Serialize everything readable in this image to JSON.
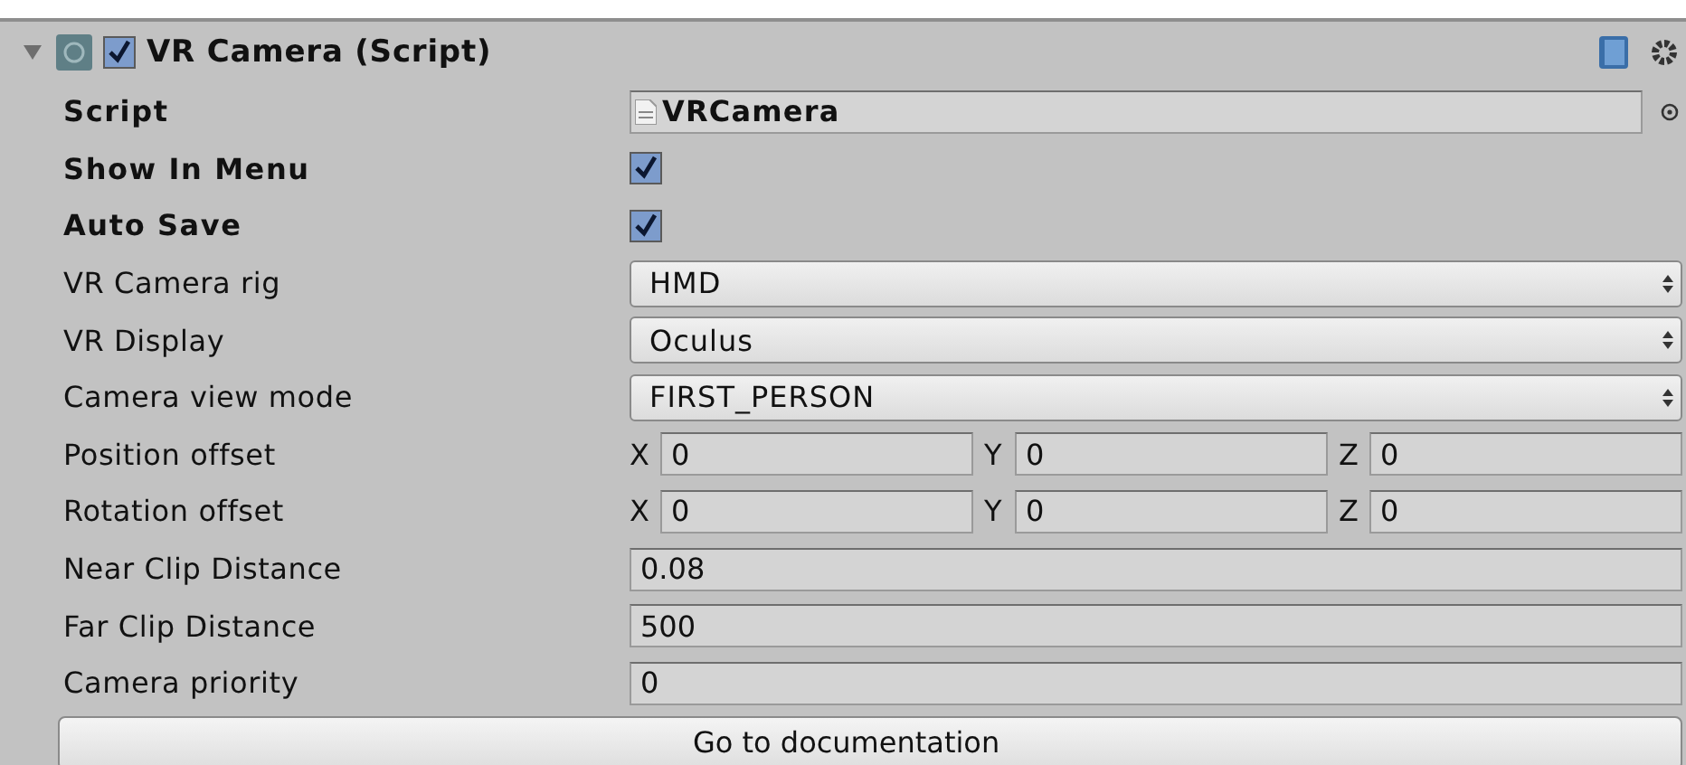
{
  "component": {
    "title": "VR Camera (Script)",
    "expanded": true,
    "enabled": true
  },
  "rows": [
    {
      "kind": "object",
      "label": "Script",
      "bold": true,
      "value": "VRCamera"
    },
    {
      "kind": "checkbox",
      "label": "Show In Menu",
      "bold": true,
      "checked": true
    },
    {
      "kind": "checkbox",
      "label": "Auto Save",
      "bold": true,
      "checked": true
    },
    {
      "kind": "dropdown",
      "label": "VR Camera rig",
      "bold": false,
      "value": "HMD"
    },
    {
      "kind": "dropdown",
      "label": "VR Display",
      "bold": false,
      "value": "Oculus"
    },
    {
      "kind": "dropdown",
      "label": "Camera view mode",
      "bold": false,
      "value": "FIRST_PERSON"
    },
    {
      "kind": "vector",
      "label": "Position offset",
      "bold": false,
      "axes": [
        {
          "axis": "X",
          "value": "0"
        },
        {
          "axis": "Y",
          "value": "0"
        },
        {
          "axis": "Z",
          "value": "0"
        }
      ]
    },
    {
      "kind": "vector",
      "label": "Rotation offset",
      "bold": false,
      "axes": [
        {
          "axis": "X",
          "value": "0"
        },
        {
          "axis": "Y",
          "value": "0"
        },
        {
          "axis": "Z",
          "value": "0"
        }
      ]
    },
    {
      "kind": "text",
      "label": "Near Clip Distance",
      "bold": false,
      "value": "0.08"
    },
    {
      "kind": "text",
      "label": "Far Clip Distance",
      "bold": false,
      "value": "500"
    },
    {
      "kind": "text",
      "label": "Camera priority",
      "bold": false,
      "value": "0"
    }
  ],
  "button": "Go to documentation"
}
